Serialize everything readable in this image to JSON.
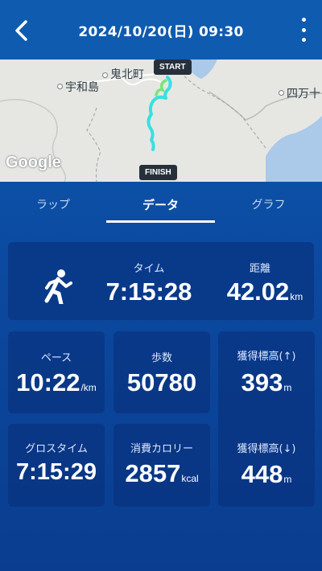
{
  "header": {
    "title": "2024/10/20(日) 09:30"
  },
  "map": {
    "places": [
      "鬼北町",
      "宇和島",
      "四万十"
    ],
    "start_label": "START",
    "finish_label": "FINISH",
    "provider_logo": "Google",
    "route_color": "#38e0e0"
  },
  "tabs": [
    {
      "label": "ラップ",
      "active": false
    },
    {
      "label": "データ",
      "active": true
    },
    {
      "label": "グラフ",
      "active": false
    }
  ],
  "stats": {
    "time": {
      "label": "タイム",
      "value": "7:15:28"
    },
    "distance": {
      "label": "距離",
      "value": "42.02",
      "unit": "km"
    },
    "pace": {
      "label": "ペース",
      "value": "10:22",
      "unit": "/km"
    },
    "steps": {
      "label": "歩数",
      "value": "50780"
    },
    "elev_gain": {
      "label": "獲得標高(↑)",
      "value": "393",
      "unit": "m"
    },
    "gross_time": {
      "label": "グロスタイム",
      "value": "7:15:29"
    },
    "calories": {
      "label": "消費カロリー",
      "value": "2857",
      "unit": "kcal"
    },
    "elev_loss": {
      "label": "獲得標高(↓)",
      "value": "448",
      "unit": "m"
    }
  },
  "icons": {
    "back": "back-arrow-icon",
    "menu": "more-vert-icon",
    "activity": "running-person-icon"
  }
}
